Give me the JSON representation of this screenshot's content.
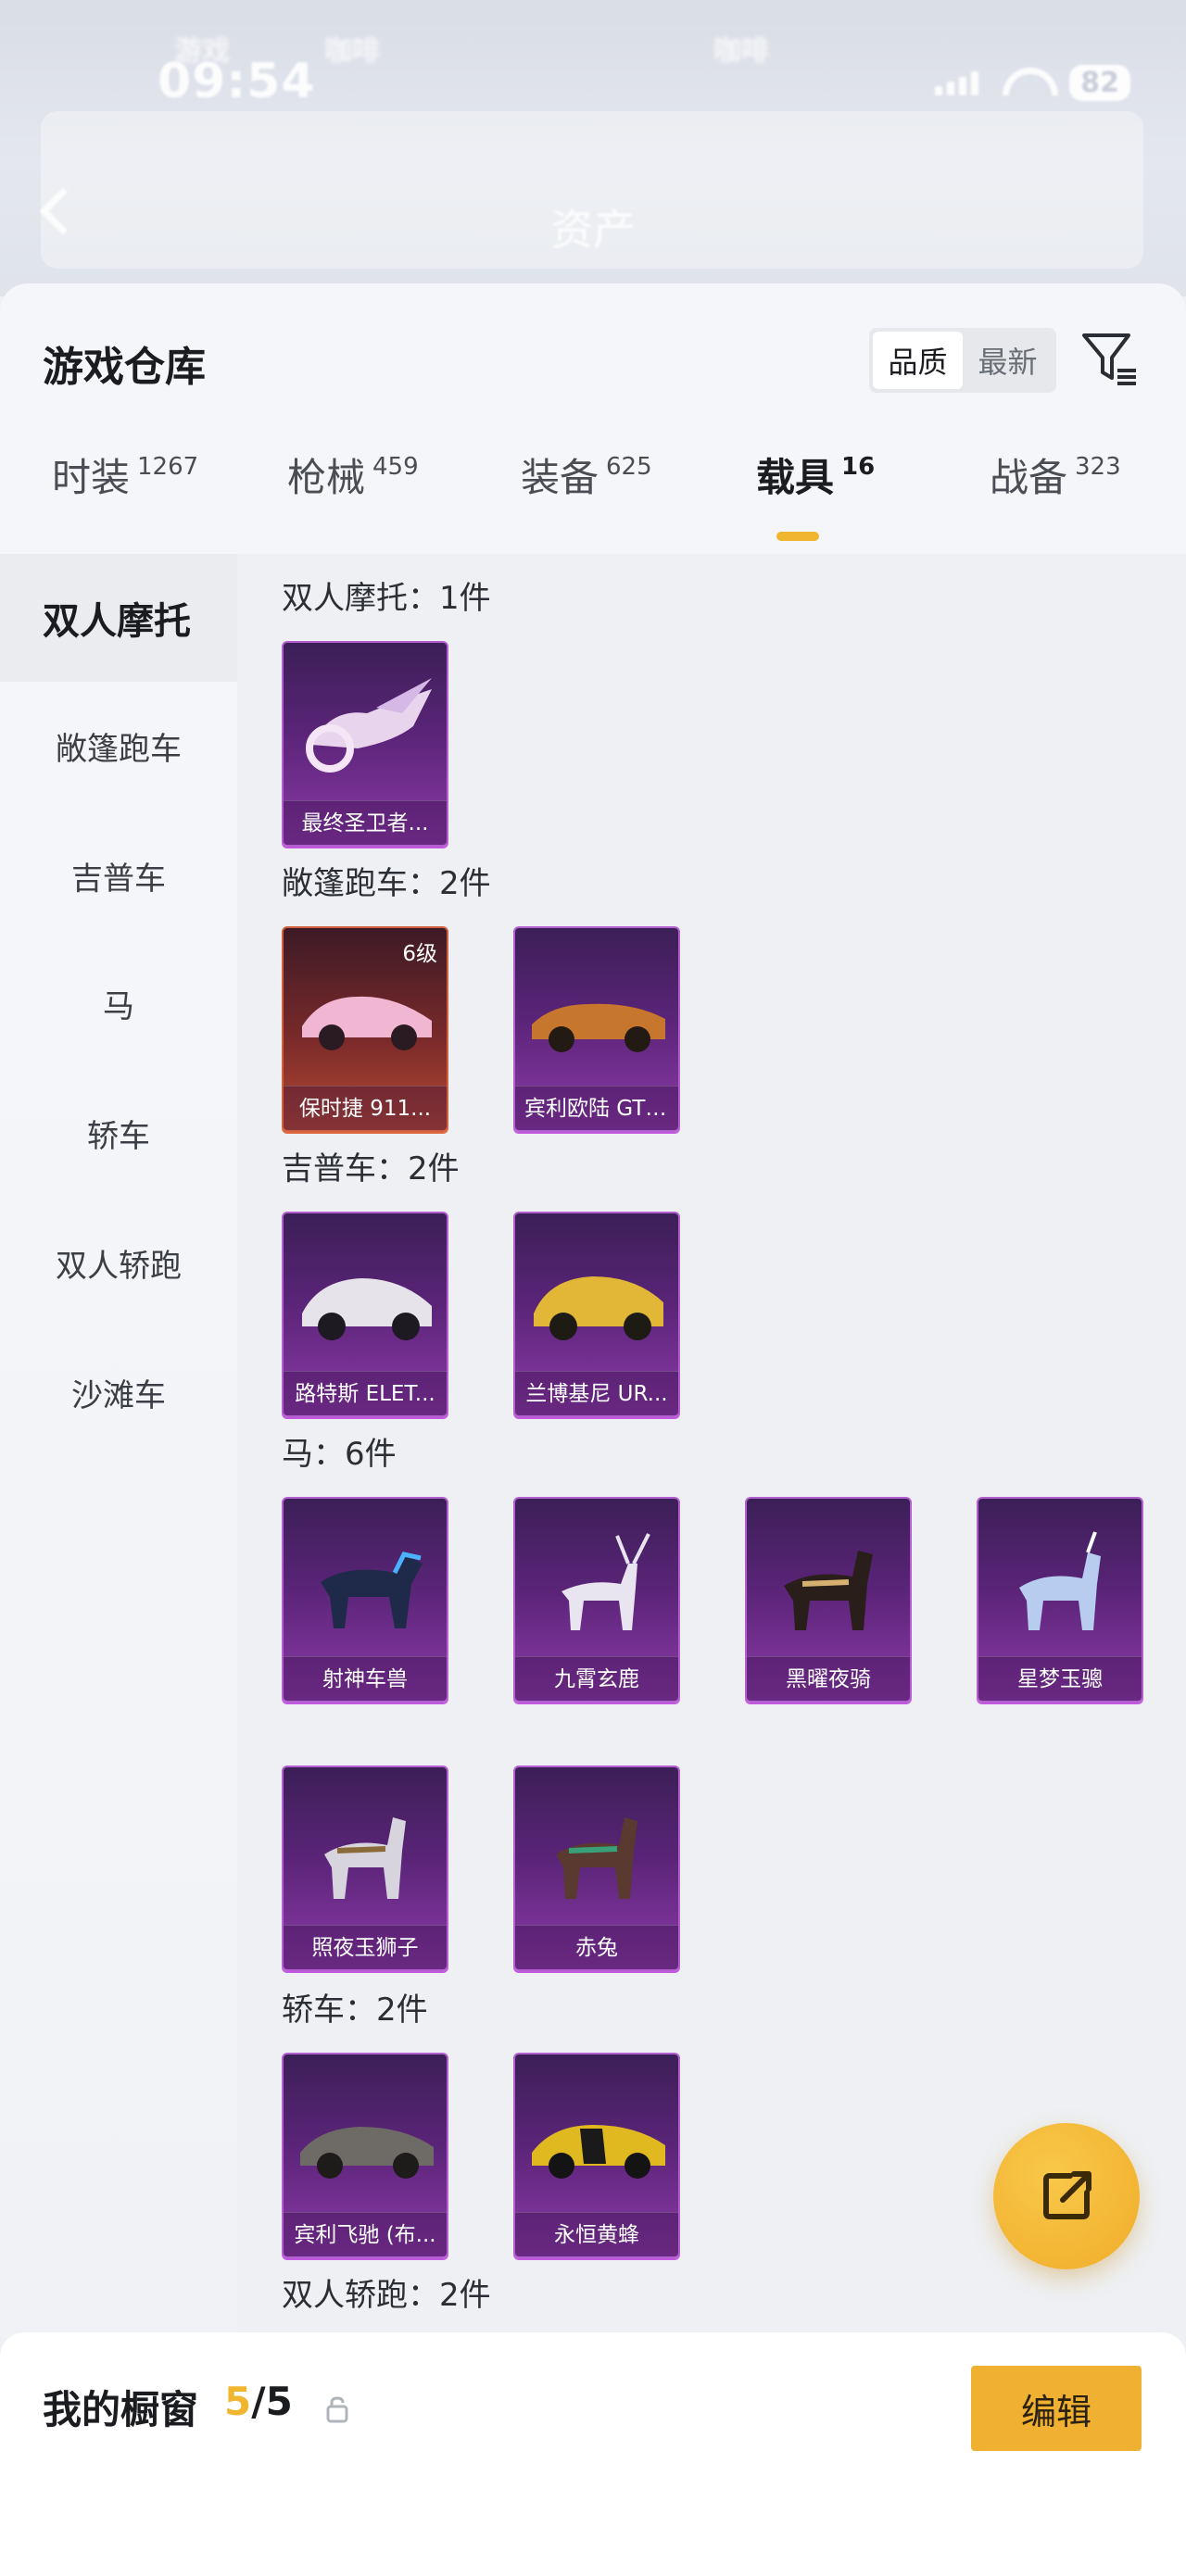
{
  "status_bar": {
    "time": "09:54",
    "battery": "82",
    "faded_texts": [
      "游戏",
      "咖啡",
      "咖啡"
    ]
  },
  "header": {
    "title": "资产"
  },
  "warehouse": {
    "title": "游戏仓库",
    "sort": {
      "options": [
        "品质",
        "最新"
      ],
      "selected": "品质"
    }
  },
  "category_tabs": [
    {
      "label": "时装",
      "count": "1267"
    },
    {
      "label": "枪械",
      "count": "459"
    },
    {
      "label": "装备",
      "count": "625"
    },
    {
      "label": "载具",
      "count": "16",
      "active": true
    },
    {
      "label": "战备",
      "count": "323"
    }
  ],
  "sidebar": {
    "items": [
      {
        "label": "双人摩托",
        "active": true
      },
      {
        "label": "敞篷跑车"
      },
      {
        "label": "吉普车"
      },
      {
        "label": "马"
      },
      {
        "label": "轿车"
      },
      {
        "label": "双人轿跑"
      },
      {
        "label": "沙滩车"
      }
    ]
  },
  "sections": [
    {
      "title": "双人摩托：1件",
      "items": [
        {
          "name": "最终圣卫者..."
        }
      ]
    },
    {
      "title": "敞篷跑车：2件",
      "items": [
        {
          "name": "保时捷 911...",
          "level": "6级",
          "rarity": "red"
        },
        {
          "name": "宾利欧陆 GT ..."
        }
      ]
    },
    {
      "title": "吉普车：2件",
      "items": [
        {
          "name": "路特斯 ELET..."
        },
        {
          "name": "兰博基尼 UR..."
        }
      ]
    },
    {
      "title": "马：6件",
      "items": [
        {
          "name": "射神车兽"
        },
        {
          "name": "九霄玄鹿"
        },
        {
          "name": "黑曜夜骑"
        },
        {
          "name": "星梦玉骢"
        },
        {
          "name": "照夜玉狮子"
        },
        {
          "name": "赤兔"
        }
      ]
    },
    {
      "title": "轿车：2件",
      "items": [
        {
          "name": "宾利飞驰 (布..."
        },
        {
          "name": "永恒黄蜂"
        }
      ]
    },
    {
      "title": "双人轿跑：2件",
      "items": []
    }
  ],
  "showcase": {
    "label": "我的橱窗",
    "current": "5",
    "total": "/5"
  },
  "edit_button": {
    "label": "编辑"
  },
  "colors": {
    "accent": "#f1b630",
    "card_purple": "#8d3aa8",
    "card_red": "#b84a33"
  }
}
